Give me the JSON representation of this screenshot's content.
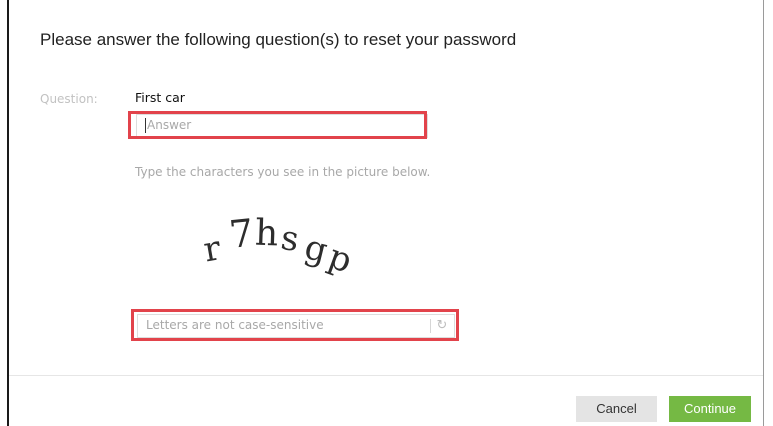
{
  "dialog": {
    "heading": "Please answer the following question(s) to reset your password"
  },
  "question": {
    "label": "Question:",
    "value": "First car"
  },
  "answer_input": {
    "value": "",
    "placeholder": "Answer"
  },
  "captcha": {
    "hint": "Type the characters you see in the picture below.",
    "image_text": "r7hsgp",
    "input_value": "",
    "input_placeholder": "Letters are not case-sensitive",
    "refresh_icon": "refresh-icon"
  },
  "buttons": {
    "cancel_label": "Cancel",
    "continue_label": "Continue"
  },
  "colors": {
    "highlight": "#e2434b",
    "continue_bg": "#75b944",
    "cancel_bg": "#e4e4e4"
  }
}
